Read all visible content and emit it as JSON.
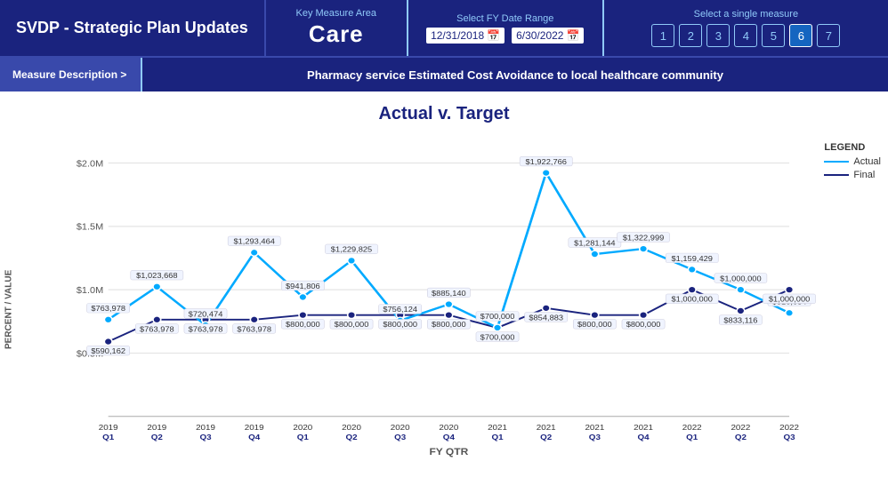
{
  "header": {
    "title": "SVDP - Strategic Plan Updates",
    "key_measure_area_label": "Key Measure Area",
    "key_measure_value": "Care",
    "date_range_label": "Select FY Date Range",
    "date_start": "12/31/2018",
    "date_end": "6/30/2022",
    "single_measure_label": "Select a single measure",
    "measure_buttons": [
      "1",
      "2",
      "3",
      "4",
      "5",
      "6",
      "7"
    ],
    "active_measure": 6
  },
  "sub_header": {
    "measure_desc_btn": "Measure Description >",
    "description": "Pharmacy service Estimated Cost Avoidance to local healthcare community"
  },
  "chart": {
    "title": "Actual v. Target",
    "y_axis_label": "PERCENT / VALUE",
    "x_axis_label": "FY QTR",
    "y_ticks": [
      "$0.5M",
      "$1.0M",
      "$1.5M",
      "$2.0M"
    ],
    "legend": {
      "title": "LEGEND",
      "items": [
        {
          "label": "Actual",
          "color": "#00aaff",
          "type": "actual"
        },
        {
          "label": "Final",
          "color": "#1a237e",
          "type": "final"
        }
      ]
    },
    "quarters": [
      "2019 Q1",
      "2019 Q2",
      "2019 Q3",
      "2019 Q4",
      "2020 Q1",
      "2020 Q2",
      "2020 Q3",
      "2020 Q4",
      "2021 Q1",
      "2021 Q2",
      "2021 Q3",
      "2021 Q4",
      "2022 Q1",
      "2022 Q2",
      "2022 Q3"
    ],
    "actual": [
      763978,
      1023668,
      720474,
      1293464,
      941806,
      1229825,
      756124,
      885140,
      700000,
      1922766,
      1281144,
      1322999,
      1159429,
      1000000,
      816634
    ],
    "final": [
      590162,
      763978,
      763978,
      763978,
      800000,
      800000,
      800000,
      800000,
      700000,
      854883,
      800000,
      800000,
      1000000,
      833116,
      1000000
    ]
  }
}
